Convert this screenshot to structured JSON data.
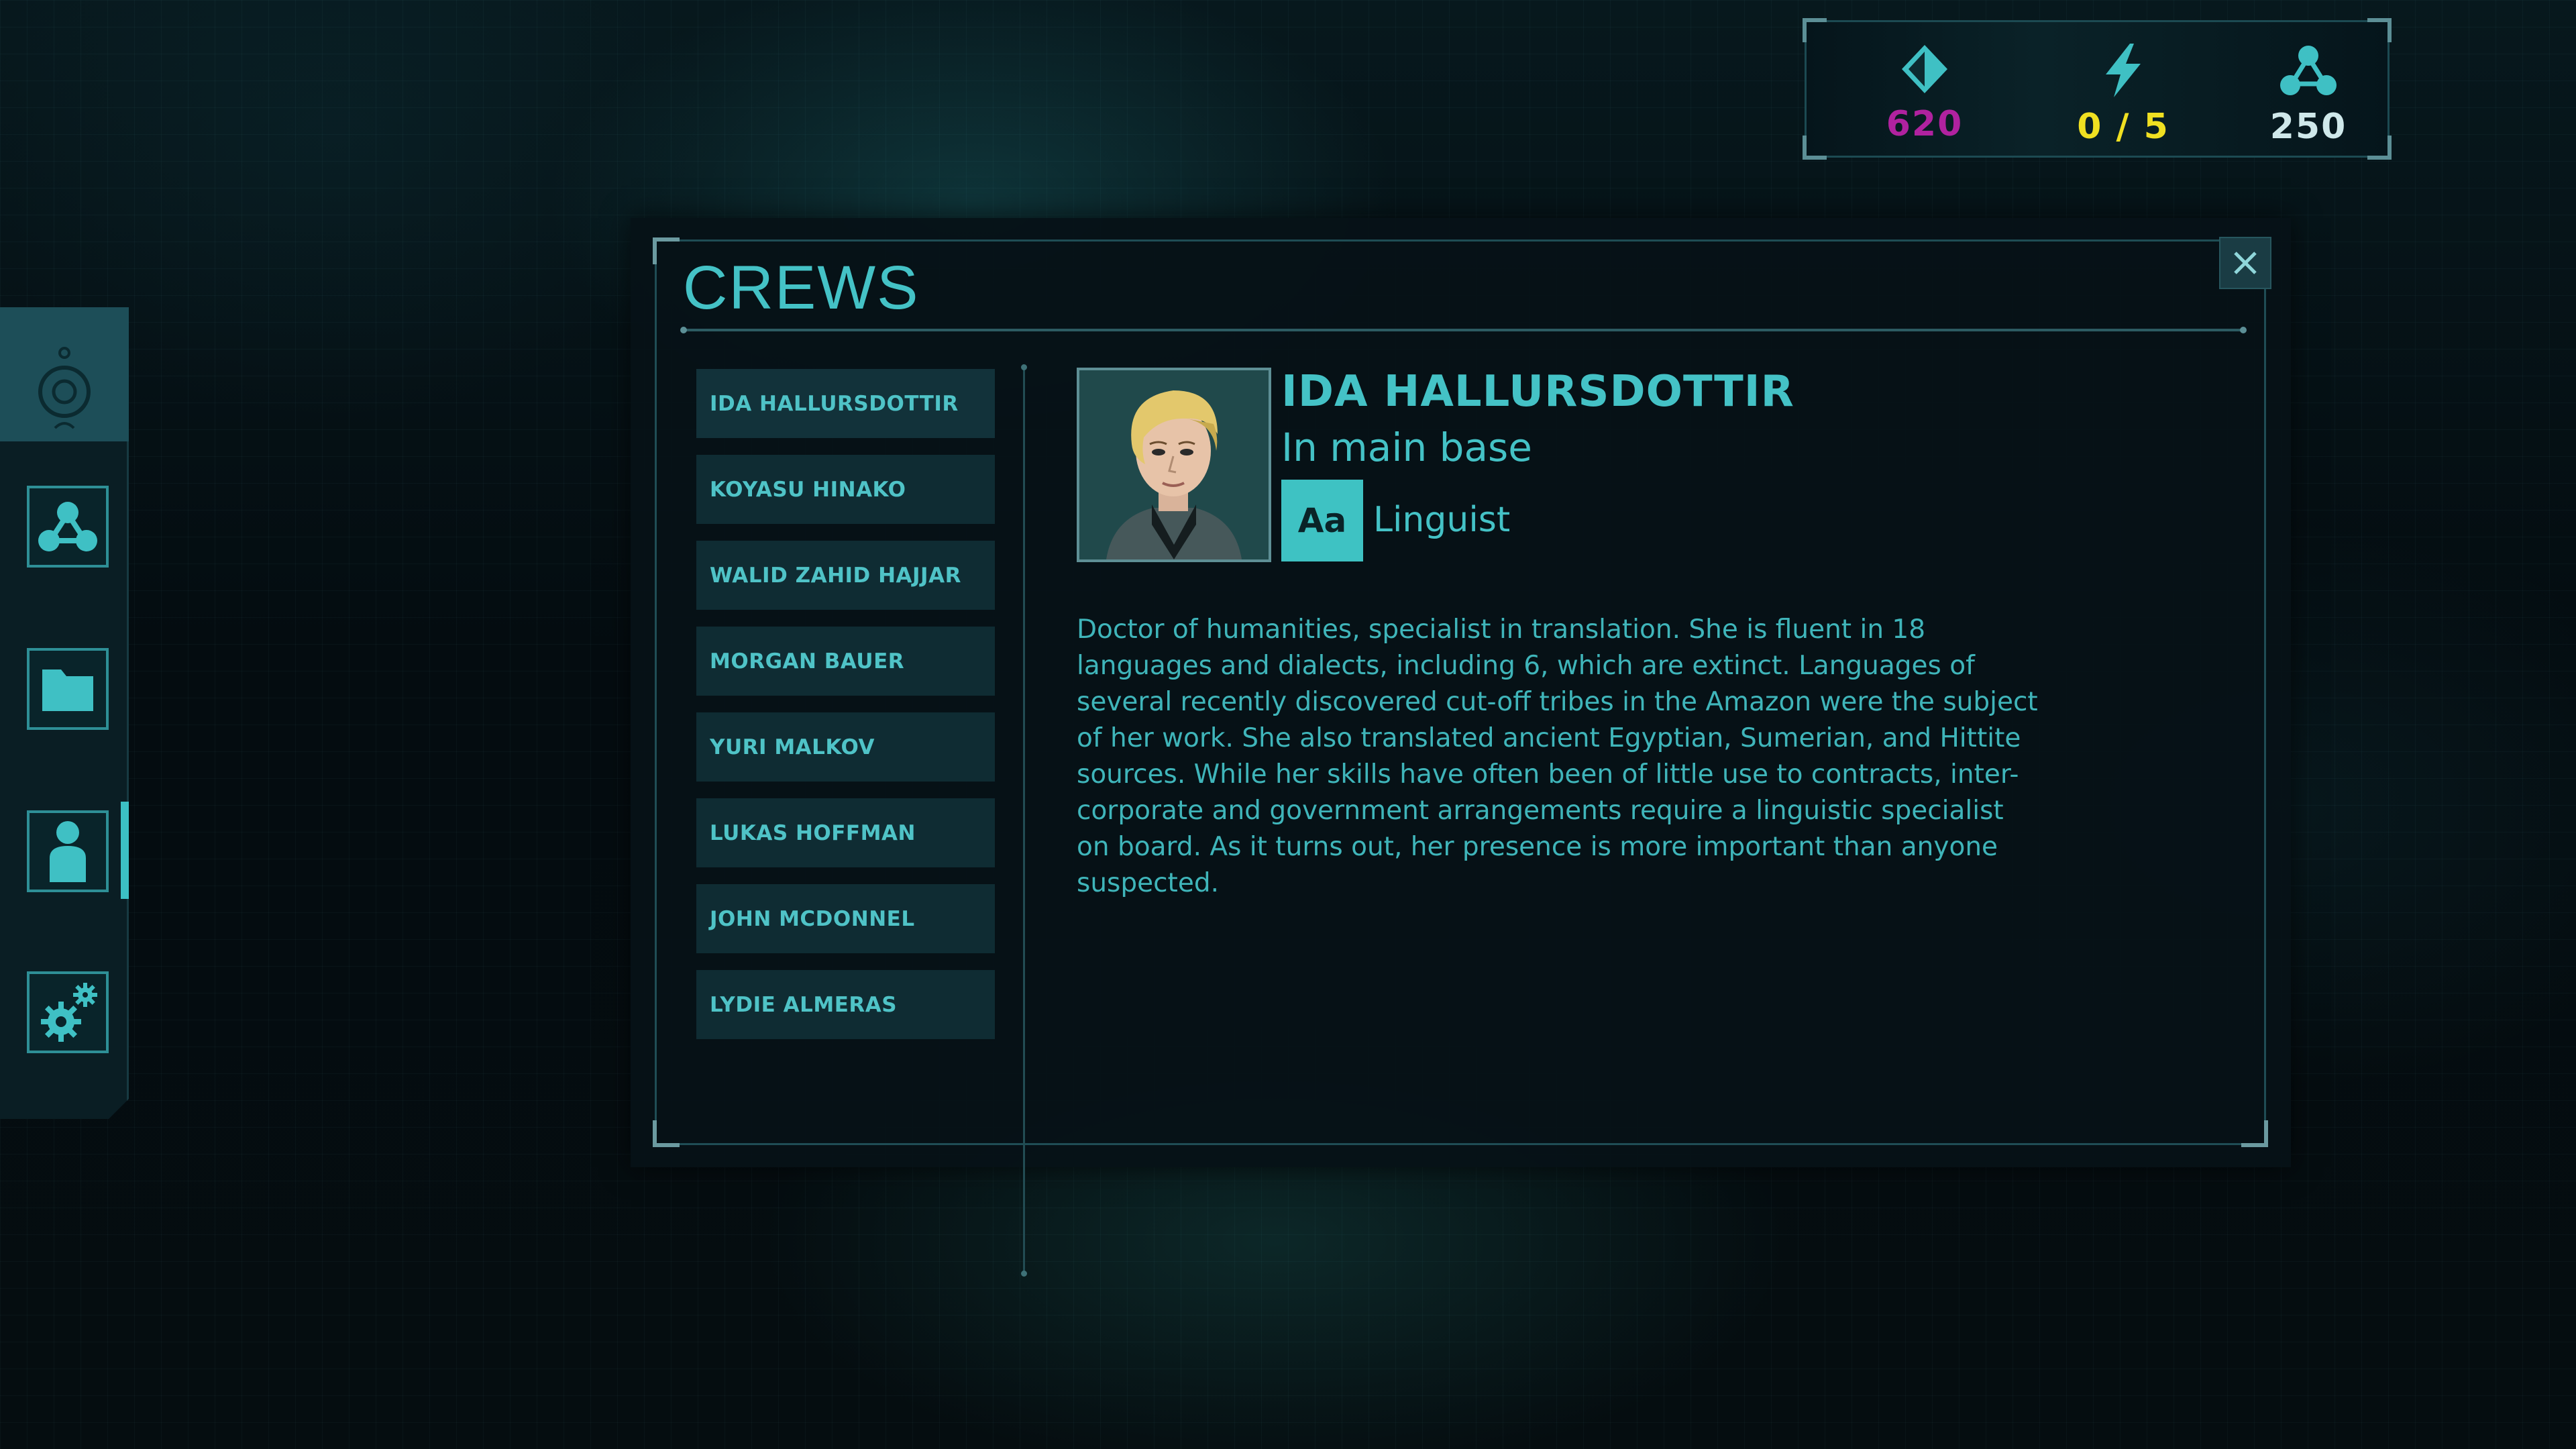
{
  "resources": {
    "credits": {
      "icon": "diamond-icon",
      "value": "620",
      "color": "#b0229f"
    },
    "energy": {
      "icon": "lightning-icon",
      "value": "0 / 5",
      "color": "#f0e021"
    },
    "network": {
      "icon": "network-nodes-icon",
      "value": "250",
      "color": "#cfe8ea"
    }
  },
  "sidebar": {
    "items": [
      {
        "id": "network",
        "icon": "network-nodes-icon"
      },
      {
        "id": "files",
        "icon": "folder-icon"
      },
      {
        "id": "crews",
        "icon": "person-icon",
        "active": true
      },
      {
        "id": "settings",
        "icon": "gears-icon"
      }
    ]
  },
  "panel": {
    "title": "CREWS",
    "crew_list": [
      "IDA HALLURSDOTTIR",
      "KOYASU HINAKO",
      "WALID ZAHID HAJJAR",
      "MORGAN BAUER",
      "YURI MALKOV",
      "LUKAS HOFFMAN",
      "JOHN MCDONNEL",
      "LYDIE ALMERAS"
    ],
    "selected": {
      "name": "IDA HALLURSDOTTIR",
      "location": "In main base",
      "role_badge": "Aa",
      "role": "Linguist",
      "description": "Doctor of humanities, specialist in translation. She is fluent in 18 languages and dialects, including 6, which are extinct. Languages of several recently discovered cut-off tribes in the Amazon were the subject of her work. She also translated ancient Egyptian, Sumerian, and Hittite sources. While her skills have often been of little use to contracts, inter-corporate and government arrangements require a linguistic specialist on board. As it turns out, her presence is more important than anyone suspected."
    }
  },
  "colors": {
    "accent": "#44c2c6",
    "panel_bg": "#061217",
    "item_bg": "#0f2c33"
  }
}
